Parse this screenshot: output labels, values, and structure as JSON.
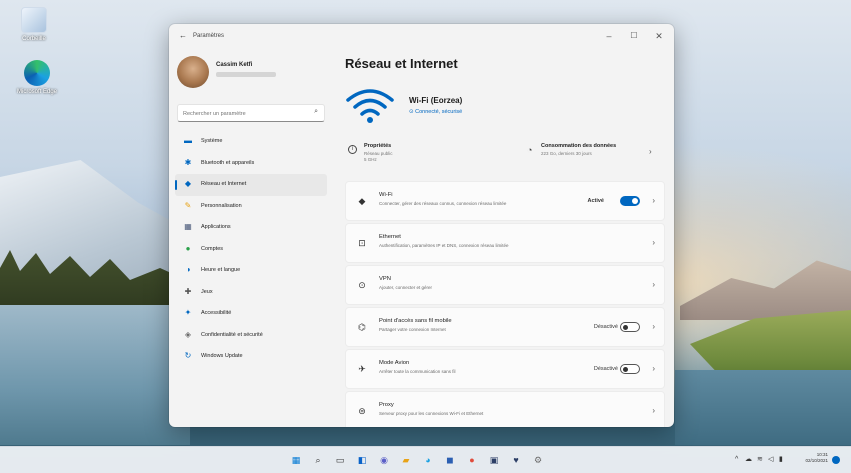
{
  "desktop": {
    "icons": [
      {
        "label": "Corbeille"
      },
      {
        "label": "Microsoft Edge"
      }
    ]
  },
  "window": {
    "title": "Paramètres",
    "controls": {
      "minimize": "–",
      "maximize": "☐",
      "close": "✕"
    }
  },
  "profile": {
    "name": "Cassim Ketfi"
  },
  "search": {
    "placeholder": "Rechercher un paramètre"
  },
  "nav": {
    "items": [
      {
        "label": "Système",
        "icon": "display-icon",
        "color": "#0067c0"
      },
      {
        "label": "Bluetooth et appareils",
        "icon": "bluetooth-icon",
        "color": "#0067c0"
      },
      {
        "label": "Réseau et Internet",
        "icon": "wifi-icon",
        "color": "#0067c0",
        "active": true
      },
      {
        "label": "Personnalisation",
        "icon": "brush-icon",
        "color": "#e8a317"
      },
      {
        "label": "Applications",
        "icon": "apps-icon",
        "color": "#4a5a7a"
      },
      {
        "label": "Comptes",
        "icon": "person-icon",
        "color": "#2aa14a"
      },
      {
        "label": "Heure et langue",
        "icon": "globe-clock-icon",
        "color": "#0067c0"
      },
      {
        "label": "Jeux",
        "icon": "gamepad-icon",
        "color": "#555555"
      },
      {
        "label": "Accessibilité",
        "icon": "accessibility-icon",
        "color": "#0067c0"
      },
      {
        "label": "Confidentialité et sécurité",
        "icon": "shield-icon",
        "color": "#6b6b6b"
      },
      {
        "label": "Windows Update",
        "icon": "update-icon",
        "color": "#0067c0"
      }
    ]
  },
  "content": {
    "page_title": "Réseau et Internet",
    "hero": {
      "ssid": "Wi-Fi (Eorzea)",
      "status": "Connecté, sécurisé"
    },
    "properties": {
      "title": "Propriétés",
      "line1": "Réseau public",
      "line2": "5 GHz"
    },
    "data_usage": {
      "title": "Consommation des données",
      "subtitle": "223 Go, derniers 30 jours"
    },
    "cards": [
      {
        "title": "Wi-Fi",
        "desc": "Connecter, gérer des réseaux connus, connexion réseau limitée",
        "status": "Activé",
        "toggle": "on",
        "icon": "wifi-icon"
      },
      {
        "title": "Ethernet",
        "desc": "Authentification, paramètres IP et DNS, connexion réseau limitée",
        "status": "",
        "toggle": "none",
        "icon": "ethernet-icon"
      },
      {
        "title": "VPN",
        "desc": "Ajouter, connecter et gérer",
        "status": "",
        "toggle": "none",
        "icon": "vpn-shield-icon"
      },
      {
        "title": "Point d'accès sans fil mobile",
        "desc": "Partager votre connexion Internet",
        "status": "Désactivé",
        "toggle": "off",
        "icon": "hotspot-icon"
      },
      {
        "title": "Mode Avion",
        "desc": "Arrêter toute la communication sans fil",
        "status": "Désactivé",
        "toggle": "off",
        "icon": "airplane-icon"
      },
      {
        "title": "Proxy",
        "desc": "Serveur proxy pour les connexions Wi-Fi et Ethernet",
        "status": "",
        "toggle": "none",
        "icon": "proxy-icon"
      }
    ]
  },
  "taskbar": {
    "apps": [
      {
        "name": "start-icon",
        "glyph": "▦",
        "color": "#0078d4"
      },
      {
        "name": "search-icon",
        "glyph": "⌕",
        "color": "#333333"
      },
      {
        "name": "task-view-icon",
        "glyph": "▭",
        "color": "#333333"
      },
      {
        "name": "widgets-icon",
        "glyph": "◧",
        "color": "#0a63c9"
      },
      {
        "name": "chat-icon",
        "glyph": "◉",
        "color": "#5b5fc7"
      },
      {
        "name": "file-explorer-icon",
        "glyph": "▰",
        "color": "#e8a317"
      },
      {
        "name": "edge-icon",
        "glyph": "◕",
        "color": "#1ba1e2"
      },
      {
        "name": "store-icon",
        "glyph": "◼",
        "color": "#2b5fb2"
      },
      {
        "name": "browser-icon",
        "glyph": "●",
        "color": "#e04c3c"
      },
      {
        "name": "terminal-icon",
        "glyph": "▣",
        "color": "#2c3e66"
      },
      {
        "name": "app-icon",
        "glyph": "♥",
        "color": "#2c3e66"
      },
      {
        "name": "settings-icon",
        "glyph": "⚙",
        "color": "#6b6b6b"
      }
    ],
    "clock": {
      "time": "10:31",
      "date": "02/10/2021"
    }
  },
  "colors": {
    "accent": "#0067c0"
  }
}
